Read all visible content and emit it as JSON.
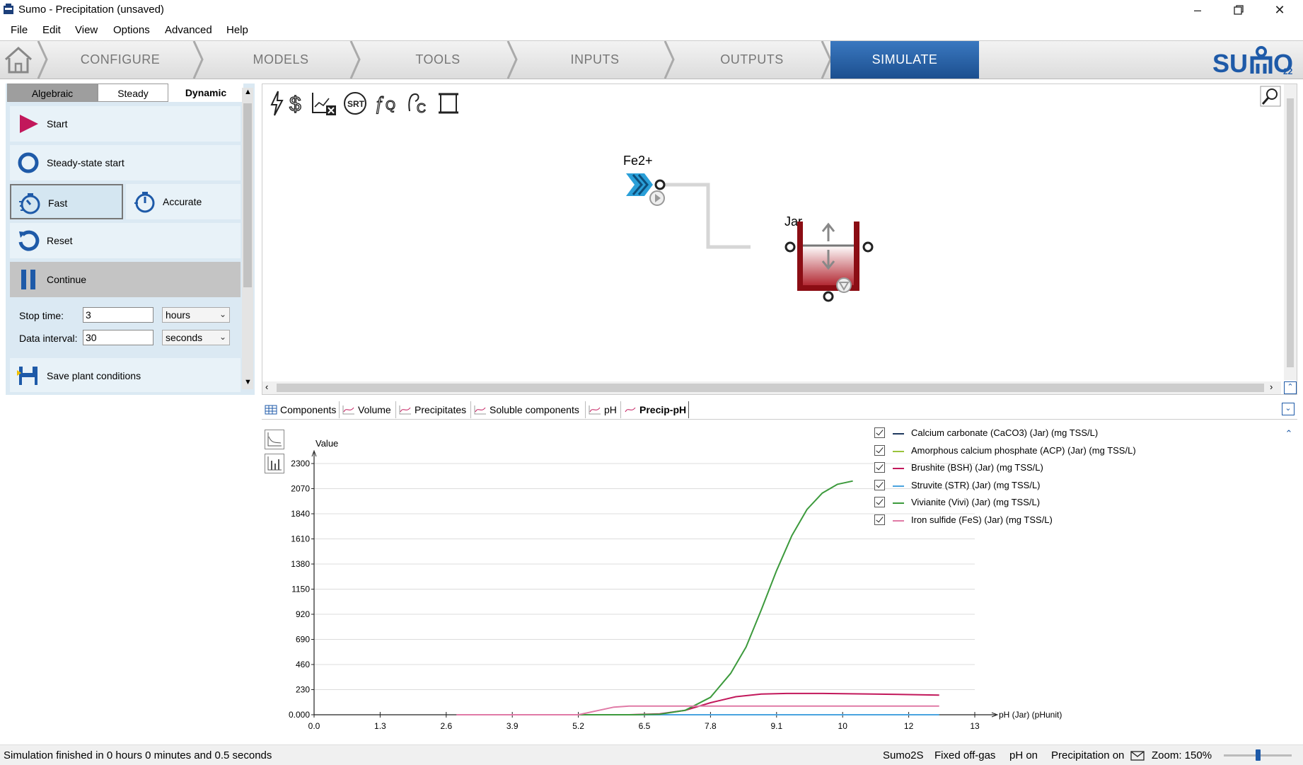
{
  "window": {
    "title": "Sumo - Precipitation (unsaved)",
    "controls": [
      "minimize-icon",
      "restore-icon",
      "close-icon"
    ]
  },
  "menu": [
    "File",
    "Edit",
    "View",
    "Options",
    "Advanced",
    "Help"
  ],
  "nav": {
    "tabs": [
      "CONFIGURE",
      "MODELS",
      "TOOLS",
      "INPUTS",
      "OUTPUTS",
      "SIMULATE"
    ],
    "active": "SIMULATE",
    "logo": "SUMO",
    "logo_version": "22"
  },
  "sim_panel": {
    "modes": [
      "Algebraic",
      "Steady",
      "Dynamic"
    ],
    "active_mode": "Dynamic",
    "buttons": {
      "start": "Start",
      "steady_start": "Steady-state start",
      "fast": "Fast",
      "accurate": "Accurate",
      "reset": "Reset",
      "continue": "Continue",
      "save": "Save plant conditions"
    },
    "stop_time": {
      "label": "Stop time:",
      "value": "3",
      "unit": "hours"
    },
    "data_interval": {
      "label": "Data interval:",
      "value": "30",
      "unit": "seconds"
    }
  },
  "flowsheet": {
    "influent_label": "Fe2+",
    "reactor_label": "Jar",
    "colors": {
      "influent": "#2a9fd8",
      "reactor": "#8b0d14",
      "pipe": "#d6d6d6"
    }
  },
  "bottom_tabs": [
    "Components",
    "Volume",
    "Precipitates",
    "Soluble components",
    "pH",
    "Precip-pH"
  ],
  "active_bottom_tab": "Precip-pH",
  "chart_data": {
    "type": "line",
    "ylabel": "Value",
    "xlabel": "pH (Jar) (pHunit)",
    "xlim": [
      0,
      13
    ],
    "ylim": [
      0,
      2300
    ],
    "x_ticks": [
      "0.0",
      "1.3",
      "2.6",
      "3.9",
      "5.2",
      "6.5",
      "7.8",
      "9.1",
      "10",
      "12",
      "13"
    ],
    "y_ticks": [
      "0.000",
      "230",
      "460",
      "690",
      "920",
      "1150",
      "1380",
      "1610",
      "1840",
      "2070",
      "2300"
    ],
    "grid": "horizontal",
    "legend_position": "top-right",
    "series": [
      {
        "name": "Calcium carbonate (CaCO3) (Jar) (mg TSS/L)",
        "color": "#1f3a5f",
        "x": [
          2.8,
          6.0,
          8.0,
          10.0,
          12.3
        ],
        "y": [
          0,
          0,
          0,
          0,
          0
        ]
      },
      {
        "name": "Amorphous calcium phosphate (ACP) (Jar) (mg TSS/L)",
        "color": "#9ac33b",
        "x": [
          2.8,
          6.0,
          8.0,
          10.0,
          12.3
        ],
        "y": [
          0,
          0,
          0,
          0,
          0
        ]
      },
      {
        "name": "Brushite (BSH) (Jar) (mg TSS/L)",
        "color": "#c2185b",
        "x": [
          2.8,
          6.2,
          6.8,
          7.3,
          7.8,
          8.3,
          8.8,
          9.3,
          10.0,
          11.0,
          12.3
        ],
        "y": [
          0,
          0,
          8,
          40,
          110,
          165,
          190,
          195,
          195,
          190,
          180
        ]
      },
      {
        "name": "Struvite (STR) (Jar) (mg TSS/L)",
        "color": "#4aa3df",
        "x": [
          2.8,
          6.0,
          8.0,
          10.0,
          12.3
        ],
        "y": [
          0,
          0,
          0,
          0,
          0
        ]
      },
      {
        "name": "Vivianite (Vivi) (Jar) (mg TSS/L)",
        "color": "#3c9a3c",
        "x": [
          2.8,
          6.3,
          6.8,
          7.3,
          7.8,
          8.2,
          8.5,
          8.8,
          9.1,
          9.4,
          9.7,
          10.0,
          10.3,
          10.6
        ],
        "y": [
          0,
          0,
          5,
          40,
          160,
          380,
          620,
          960,
          1320,
          1640,
          1880,
          2030,
          2110,
          2140
        ]
      },
      {
        "name": "Iron sulfide (FeS) (Jar) (mg TSS/L)",
        "color": "#e07aa6",
        "x": [
          2.8,
          5.2,
          5.6,
          5.9,
          6.2,
          7.0,
          8.0,
          10.0,
          12.3
        ],
        "y": [
          0,
          0,
          40,
          70,
          80,
          80,
          80,
          80,
          80
        ]
      }
    ]
  },
  "status": {
    "message": "Simulation finished in 0 hours 0 minutes and 0.5 seconds",
    "model": "Sumo2S",
    "offgas": "Fixed off-gas",
    "ph": "pH on",
    "precip": "Precipitation on",
    "zoom": "Zoom: 150%",
    "zoom_level": 0.5
  }
}
